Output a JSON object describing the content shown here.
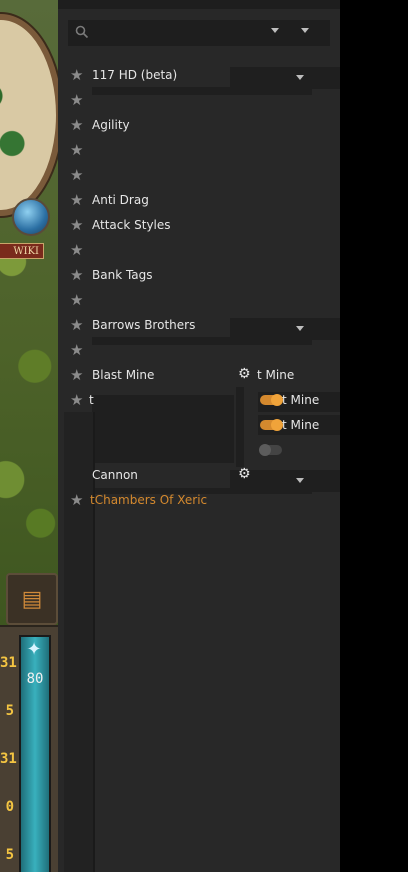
{
  "game": {
    "wiki_label": "WIKI",
    "orb_values": [
      "31",
      "5",
      "31",
      "0",
      "5"
    ],
    "run_energy": "80"
  },
  "search": {
    "placeholder": ""
  },
  "plugins": [
    {
      "name": "117 HD (beta)"
    },
    {
      "name": ""
    },
    {
      "name": "Agility"
    },
    {
      "name": ""
    },
    {
      "name": ""
    },
    {
      "name": "Anti Drag"
    },
    {
      "name": "Attack Styles"
    },
    {
      "name": ""
    },
    {
      "name": "Bank Tags"
    },
    {
      "name": ""
    },
    {
      "name": "Barrows Brothers"
    },
    {
      "name": ""
    },
    {
      "name": "Blast Mine"
    },
    {
      "name": "t"
    },
    {
      "name": ""
    },
    {
      "name": ""
    },
    {
      "name": ""
    },
    {
      "name": "Cannon"
    },
    {
      "name": "tChambers Of Xeric"
    }
  ],
  "overlay": {
    "config_label": "t Mine",
    "toggle_label_1": "t Mine",
    "toggle_label_2": "t Mine"
  },
  "colors": {
    "panel_bg": "#282828",
    "accent": "#d4892e",
    "text": "#e6e6e6"
  }
}
